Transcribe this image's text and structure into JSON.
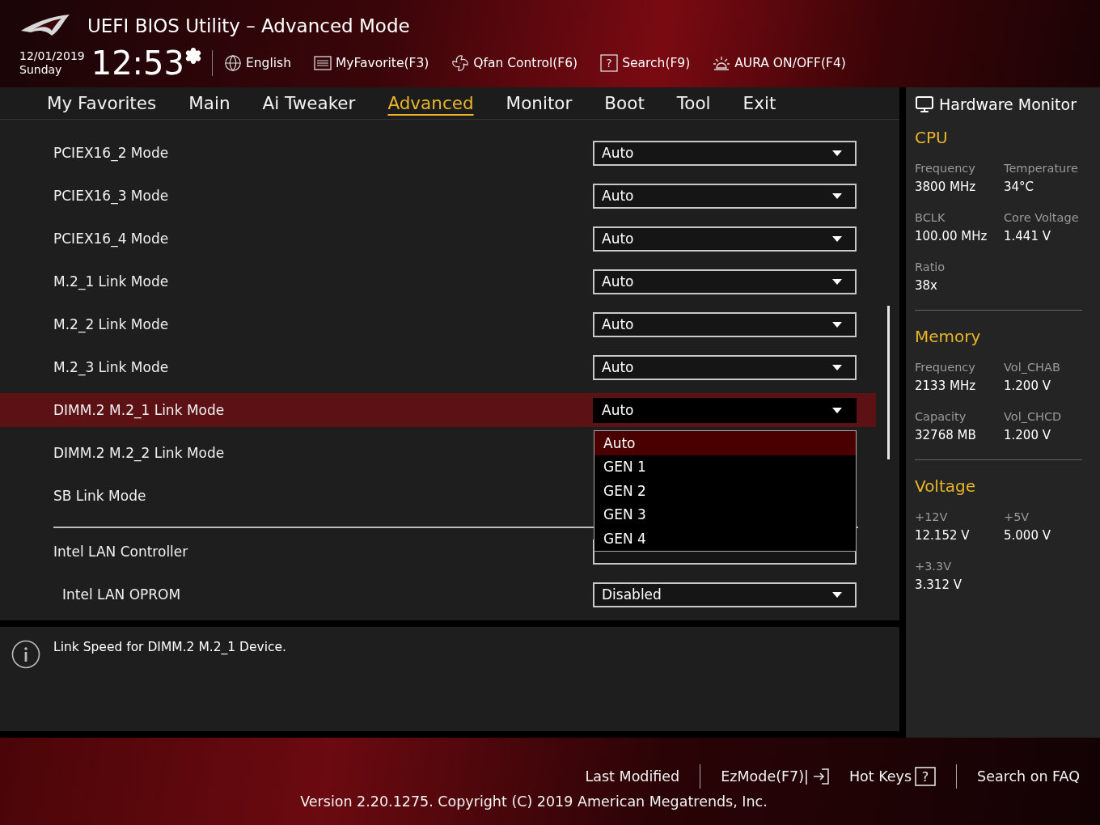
{
  "header": {
    "title": "UEFI BIOS Utility – Advanced Mode",
    "date": "12/01/2019",
    "day": "Sunday",
    "time": "12:53",
    "tools": [
      {
        "kind": "language",
        "label": "English"
      },
      {
        "kind": "favorite",
        "label": "MyFavorite(F3)"
      },
      {
        "kind": "fan",
        "label": "Qfan Control(F6)"
      },
      {
        "kind": "search",
        "label": "Search(F9)",
        "glyph": "?"
      },
      {
        "kind": "aura",
        "label": "AURA ON/OFF(F4)"
      }
    ]
  },
  "tabs": [
    {
      "label": "My Favorites",
      "selected": false
    },
    {
      "label": "Main",
      "selected": false
    },
    {
      "label": "Ai Tweaker",
      "selected": false
    },
    {
      "label": "Advanced",
      "selected": true
    },
    {
      "label": "Monitor",
      "selected": false
    },
    {
      "label": "Boot",
      "selected": false
    },
    {
      "label": "Tool",
      "selected": false
    },
    {
      "label": "Exit",
      "selected": false
    }
  ],
  "setting_groups": [
    [
      {
        "label": "PCIEX16_2 Mode",
        "value": "Auto",
        "selected": false,
        "indented": false
      },
      {
        "label": "PCIEX16_3 Mode",
        "value": "Auto",
        "selected": false,
        "indented": false
      },
      {
        "label": "PCIEX16_4 Mode",
        "value": "Auto",
        "selected": false,
        "indented": false
      },
      {
        "label": "M.2_1 Link Mode",
        "value": "Auto",
        "selected": false,
        "indented": false
      },
      {
        "label": "M.2_2 Link Mode",
        "value": "Auto",
        "selected": false,
        "indented": false
      },
      {
        "label": "M.2_3 Link Mode",
        "value": "Auto",
        "selected": false,
        "indented": false
      },
      {
        "label": "DIMM.2 M.2_1 Link Mode",
        "value": "Auto",
        "selected": true,
        "indented": false,
        "options": [
          {
            "label": "Auto",
            "selected": true
          },
          {
            "label": "GEN 1",
            "selected": false
          },
          {
            "label": "GEN 2",
            "selected": false
          },
          {
            "label": "GEN 3",
            "selected": false
          },
          {
            "label": "GEN 4",
            "selected": false
          }
        ]
      },
      {
        "label": "DIMM.2 M.2_2 Link Mode",
        "selected": false,
        "indented": false,
        "kind": "covered"
      },
      {
        "label": "SB Link Mode",
        "selected": false,
        "indented": false,
        "kind": "covered"
      }
    ],
    [
      {
        "label": "Intel LAN Controller",
        "selected": false,
        "indented": false
      },
      {
        "label": "Intel LAN OPROM",
        "value": "Disabled",
        "selected": false,
        "indented": true
      }
    ]
  ],
  "help": {
    "text": "Link Speed for DIMM.2 M.2_1 Device."
  },
  "monitor": {
    "title": "Hardware Monitor",
    "sections": [
      {
        "title": "CPU",
        "items": [
          {
            "label": "Frequency",
            "value": "3800 MHz"
          },
          {
            "label": "Temperature",
            "value": "34°C"
          },
          {
            "label": "BCLK",
            "value": "100.00 MHz"
          },
          {
            "label": "Core Voltage",
            "value": "1.441 V"
          },
          {
            "label": "Ratio",
            "value": "38x"
          }
        ]
      },
      {
        "title": "Memory",
        "items": [
          {
            "label": "Frequency",
            "value": "2133 MHz"
          },
          {
            "label": "Vol_CHAB",
            "value": "1.200 V"
          },
          {
            "label": "Capacity",
            "value": "32768 MB"
          },
          {
            "label": "Vol_CHCD",
            "value": "1.200 V"
          }
        ]
      },
      {
        "title": "Voltage",
        "items": [
          {
            "label": "+12V",
            "value": "12.152 V"
          },
          {
            "label": "+5V",
            "value": "5.000 V"
          },
          {
            "label": "+3.3V",
            "value": "3.312 V"
          }
        ]
      }
    ]
  },
  "footer": {
    "links": [
      {
        "kind": "plain",
        "label": "Last Modified"
      },
      {
        "kind": "exit",
        "label": "EzMode(F7)|"
      },
      {
        "kind": "help",
        "label": "Hot Keys",
        "glyph": "?"
      },
      {
        "kind": "plain",
        "label": "Search on FAQ"
      }
    ],
    "version": "Version 2.20.1275. Copyright (C) 2019 American Megatrends, Inc."
  }
}
